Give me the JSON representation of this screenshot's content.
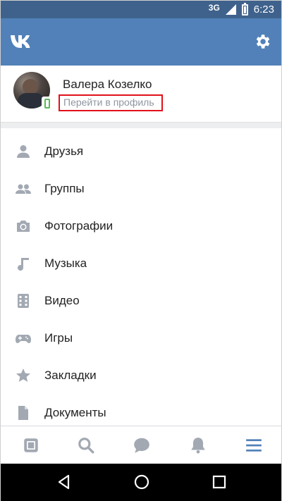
{
  "status_bar": {
    "network": "3G",
    "time": "6:23"
  },
  "app_bar": {
    "logo_text": "VK",
    "settings_icon": "gear-icon"
  },
  "profile": {
    "name": "Валера Козелко",
    "link_text": "Перейти в профиль",
    "highlight_color": "#e0111b",
    "online_badge": "mobile-phone-icon"
  },
  "menu": {
    "items": [
      {
        "label": "Друзья",
        "icon": "person-icon"
      },
      {
        "label": "Группы",
        "icon": "group-icon"
      },
      {
        "label": "Фотографии",
        "icon": "camera-icon"
      },
      {
        "label": "Музыка",
        "icon": "music-note-icon"
      },
      {
        "label": "Видео",
        "icon": "film-icon"
      },
      {
        "label": "Игры",
        "icon": "gamepad-icon"
      },
      {
        "label": "Закладки",
        "icon": "star-icon"
      },
      {
        "label": "Документы",
        "icon": "document-icon"
      }
    ]
  },
  "bottom_tabs": {
    "items": [
      {
        "icon": "news-icon",
        "active": false
      },
      {
        "icon": "search-icon",
        "active": false
      },
      {
        "icon": "messages-icon",
        "active": false
      },
      {
        "icon": "notifications-bell-icon",
        "active": false
      },
      {
        "icon": "menu-icon",
        "active": true
      }
    ]
  },
  "colors": {
    "status_bar": "#3f628c",
    "app_bar": "#5181b8",
    "icon_gray": "#a3a9b3",
    "active_tab": "#5181b8"
  }
}
